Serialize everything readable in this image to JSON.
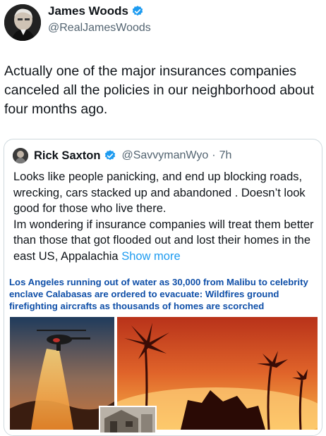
{
  "author": {
    "name": "James Woods",
    "handle": "@RealJamesWoods",
    "verified": true,
    "avatar_icon": "profile-photo-icon"
  },
  "tweet": {
    "text": "Actually one of the major insurances companies canceled all the policies in our neighborhood about four months ago."
  },
  "quoted": {
    "name": "Rick Saxton",
    "handle": "@SavvymanWyo",
    "separator": "·",
    "time": "7h",
    "verified": true,
    "text": "Looks like people panicking, and end up blocking roads, wrecking, cars stacked up and abandoned . Doesn’t look good for those who live there.\nIm wondering if insurance companies will treat them better than those that got flooded out and lost their homes in the east US, Appalachia",
    "show_more": "Show more"
  },
  "article": {
    "headline": "Los Angeles running out of water as 30,000 from Malibu to celebrity enclave Calabasas are ordered to evacuate: Wildfires ground firefighting aircrafts as thousands of homes are scorched"
  },
  "colors": {
    "verified": "#1d9bf0",
    "link": "#1d9bf0",
    "headline": "#0f4fa8",
    "secondary_text": "#536471"
  }
}
